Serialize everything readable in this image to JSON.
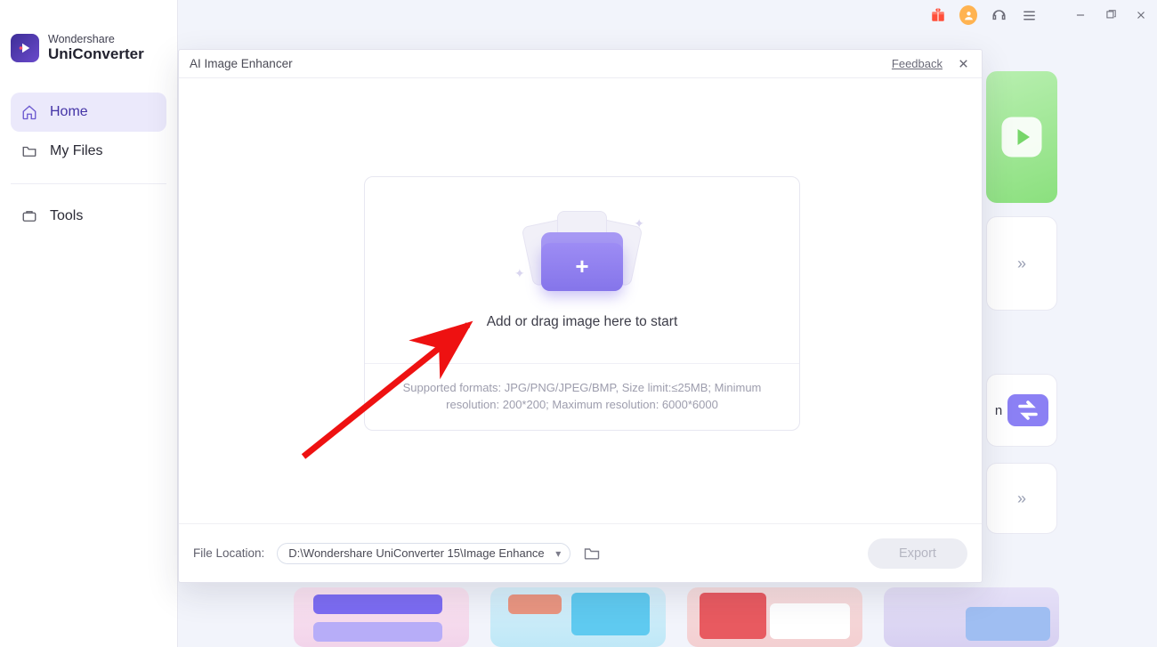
{
  "brand": {
    "top": "Wondershare",
    "name": "UniConverter"
  },
  "sidebar": {
    "items": [
      {
        "label": "Home",
        "icon": "home-icon",
        "active": true
      },
      {
        "label": "My Files",
        "icon": "folder-icon",
        "active": false
      },
      {
        "label": "Tools",
        "icon": "tools-icon",
        "active": false
      }
    ]
  },
  "titlebar": {
    "icons": [
      "gift-icon",
      "avatar-icon",
      "headset-icon",
      "menu-icon",
      "minimize-icon",
      "maximize-icon",
      "close-icon"
    ]
  },
  "modal": {
    "title": "AI Image Enhancer",
    "feedback": "Feedback",
    "drop_text": "Add or drag image here to start",
    "support_text": "Supported formats: JPG/PNG/JPEG/BMP, Size limit:≤25MB; Minimum resolution: 200*200; Maximum resolution: 6000*6000",
    "footer": {
      "label": "File Location:",
      "path": "D:\\Wondershare UniConverter 15\\Image Enhance",
      "export": "Export"
    }
  },
  "background": {
    "right_label": "n",
    "bottom_thumbs_count": 4
  }
}
